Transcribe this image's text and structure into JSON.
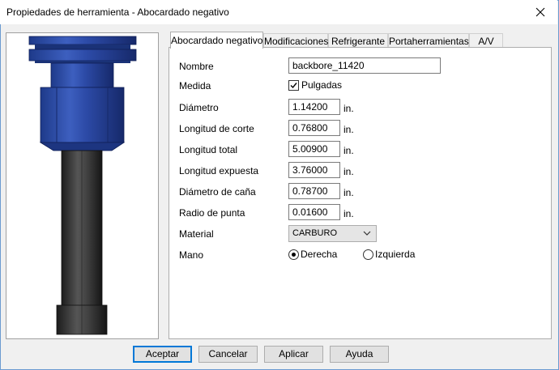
{
  "window": {
    "title": "Propiedades de herramienta - Abocardado negativo"
  },
  "tabs": [
    {
      "label": "Abocardado negativo",
      "active": true
    },
    {
      "label": "Modificaciones"
    },
    {
      "label": "Refrigerante"
    },
    {
      "label": "Portaherramientas"
    },
    {
      "label": "A/V"
    }
  ],
  "form": {
    "nombre": {
      "label": "Nombre",
      "value": "backbore_11420"
    },
    "medida": {
      "label": "Medida",
      "checkbox_label": "Pulgadas",
      "checked": true
    },
    "diametro": {
      "label": "Diámetro",
      "value": "1.14200",
      "unit": "in."
    },
    "longitud_corte": {
      "label": "Longitud de corte",
      "value": "0.76800",
      "unit": "in."
    },
    "longitud_total": {
      "label": "Longitud total",
      "value": "5.00900",
      "unit": "in."
    },
    "longitud_expuesta": {
      "label": "Longitud expuesta",
      "value": "3.76000",
      "unit": "in."
    },
    "diametro_cana": {
      "label": "Diámetro de caña",
      "value": "0.78700",
      "unit": "in."
    },
    "radio_punta": {
      "label": "Radio de punta",
      "value": "0.01600",
      "unit": "in."
    },
    "material": {
      "label": "Material",
      "value": "CARBURO"
    },
    "mano": {
      "label": "Mano",
      "options": [
        "Derecha",
        "Izquierda"
      ],
      "selected": "Derecha"
    }
  },
  "buttons": {
    "accept": "Aceptar",
    "cancel": "Cancelar",
    "apply": "Aplicar",
    "help": "Ayuda"
  },
  "colors": {
    "holder_blue": "#2b4a9c",
    "shank_dark": "#3a3a3a",
    "accent": "#0078d7"
  }
}
